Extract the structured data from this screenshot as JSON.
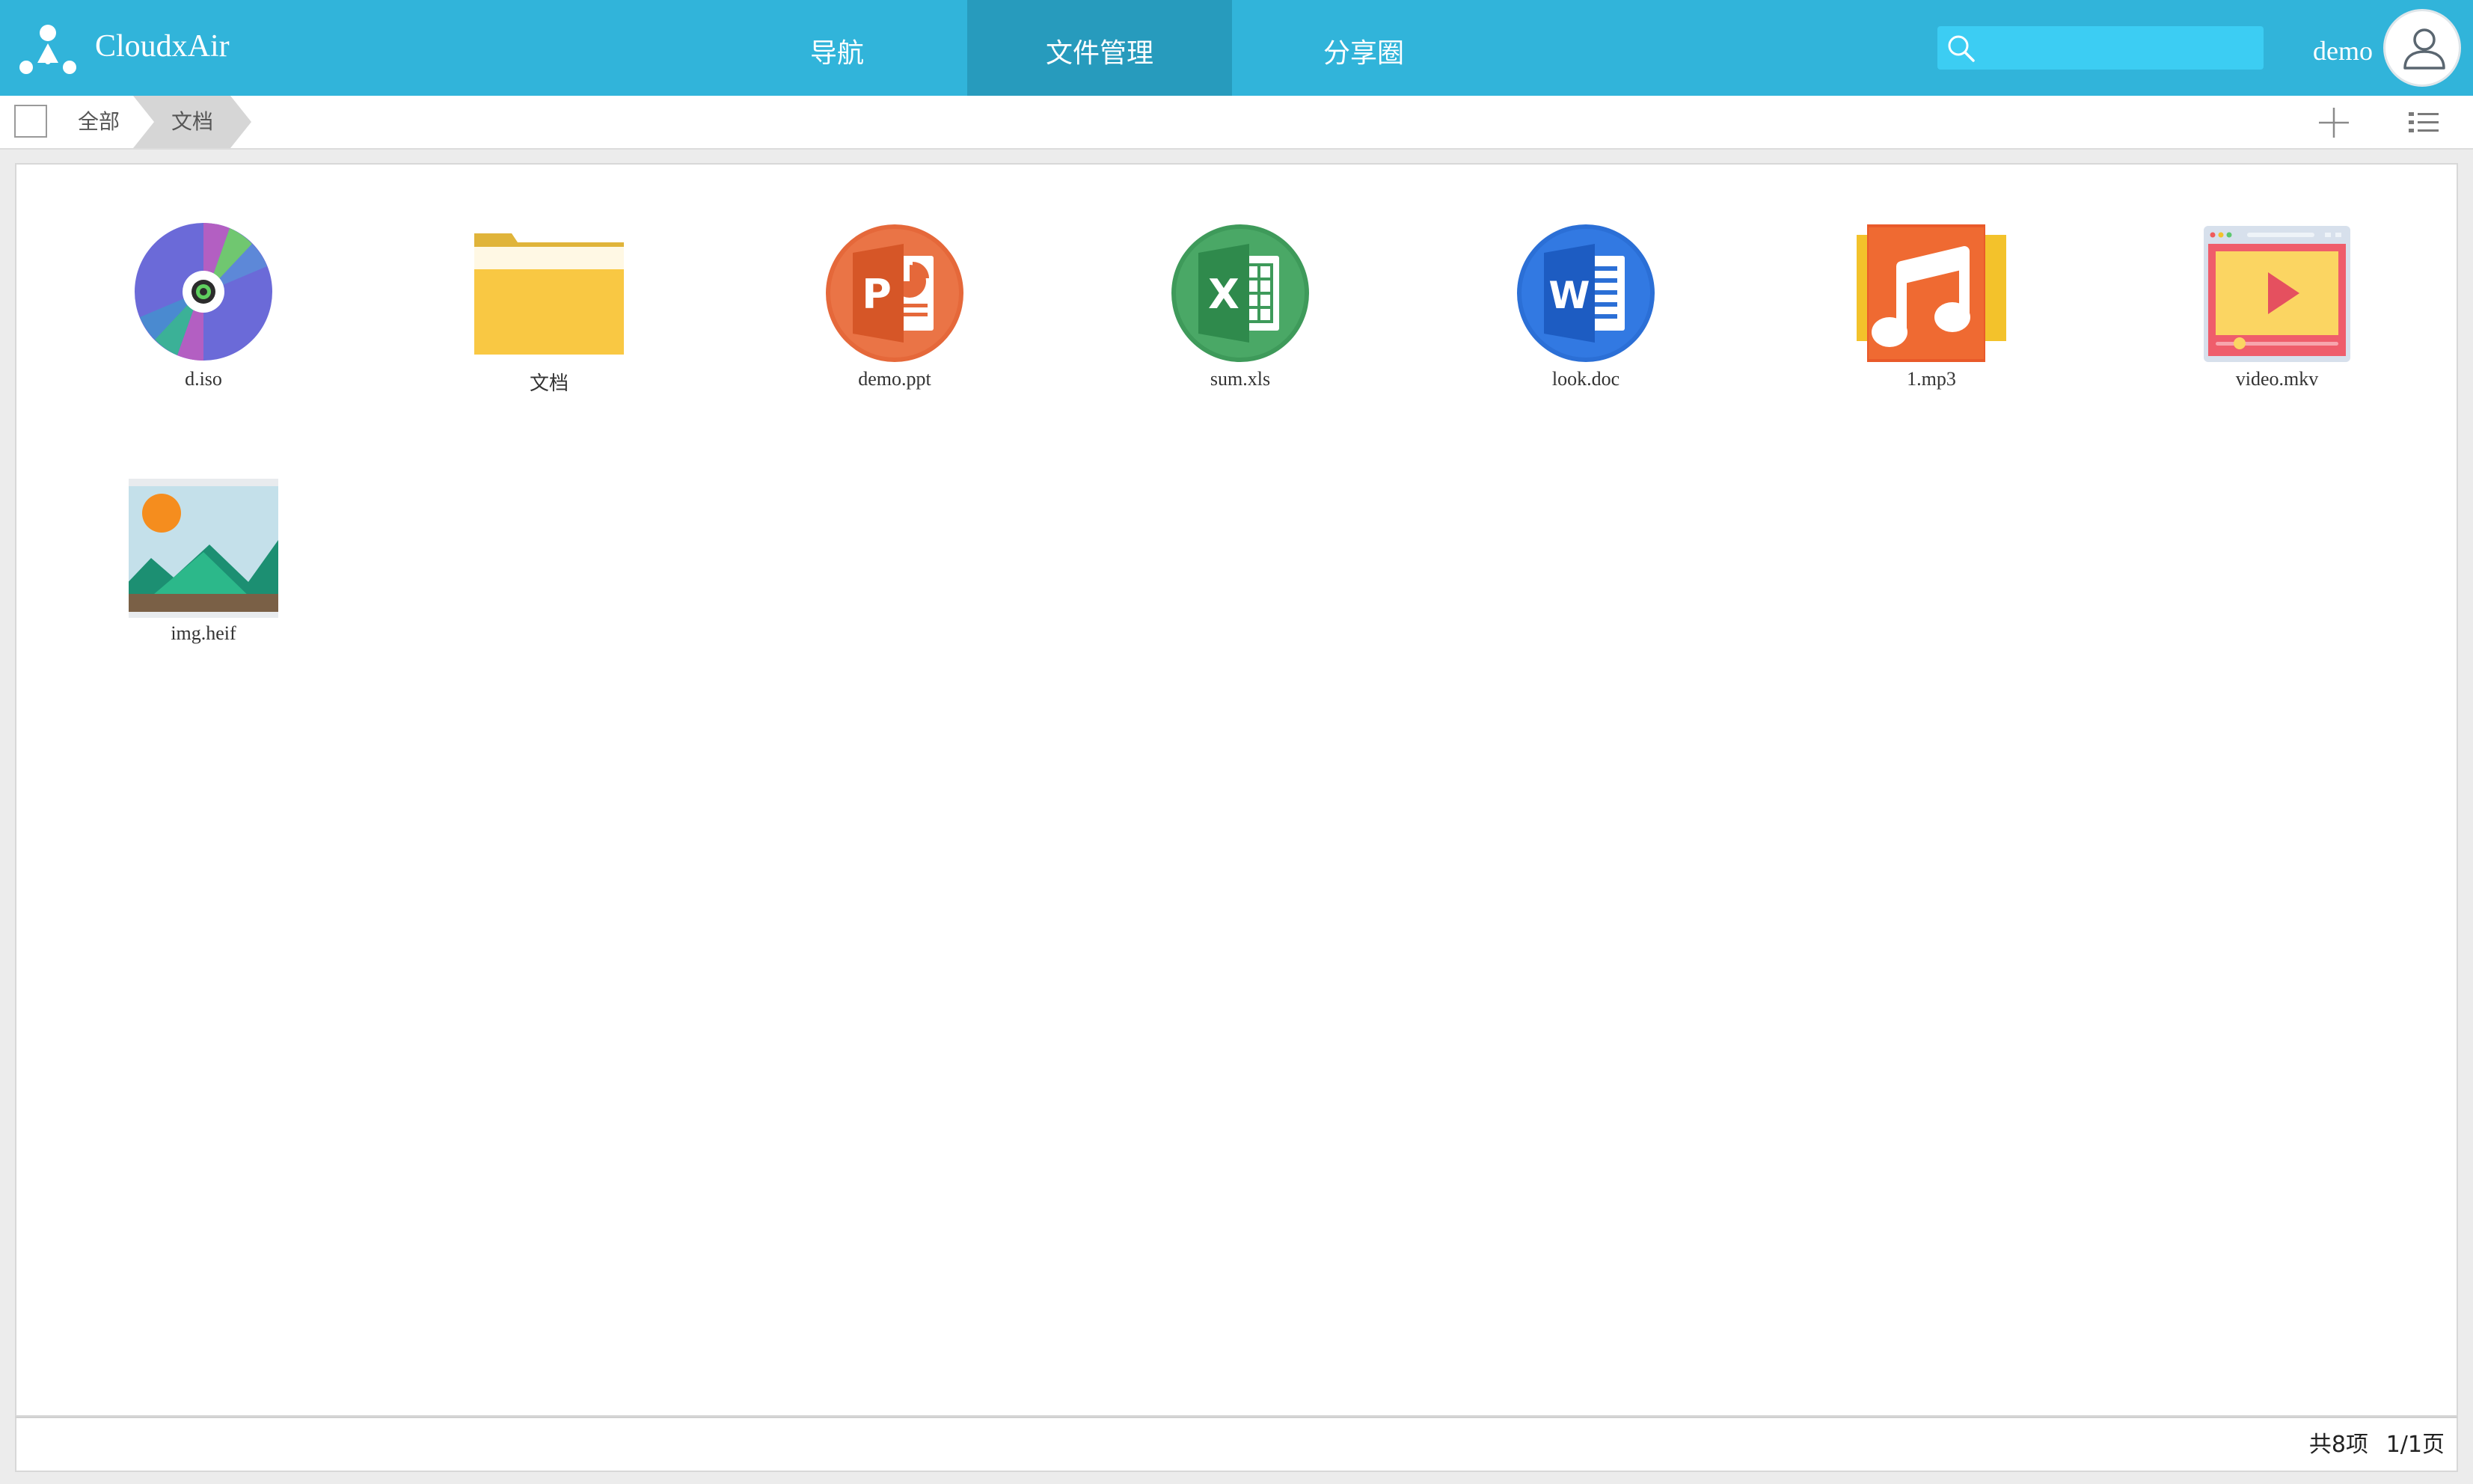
{
  "app": {
    "brand": "CloudxAir",
    "accent_color": "#31b4da",
    "active_tab_color": "#279bbd"
  },
  "nav": {
    "tabs": [
      {
        "label": "导航",
        "active": false
      },
      {
        "label": "文件管理",
        "active": true
      },
      {
        "label": "分享圈",
        "active": false
      }
    ]
  },
  "search": {
    "value": "",
    "icon": "search-icon"
  },
  "user": {
    "name": "demo",
    "icon": "user-icon"
  },
  "breadcrumb": {
    "items": [
      "全部",
      "文档"
    ]
  },
  "toolbar": {
    "add_icon": "plus-icon",
    "view_icon": "list-view-icon"
  },
  "files": [
    {
      "name": "d.iso",
      "type": "disc-image"
    },
    {
      "name": "文档",
      "type": "folder"
    },
    {
      "name": "demo.ppt",
      "type": "powerpoint"
    },
    {
      "name": "sum.xls",
      "type": "excel"
    },
    {
      "name": "look.doc",
      "type": "word"
    },
    {
      "name": "1.mp3",
      "type": "audio"
    },
    {
      "name": "video.mkv",
      "type": "video"
    },
    {
      "name": "img.heif",
      "type": "image"
    }
  ],
  "footer": {
    "count": "共8项",
    "pages": "1/1页"
  }
}
